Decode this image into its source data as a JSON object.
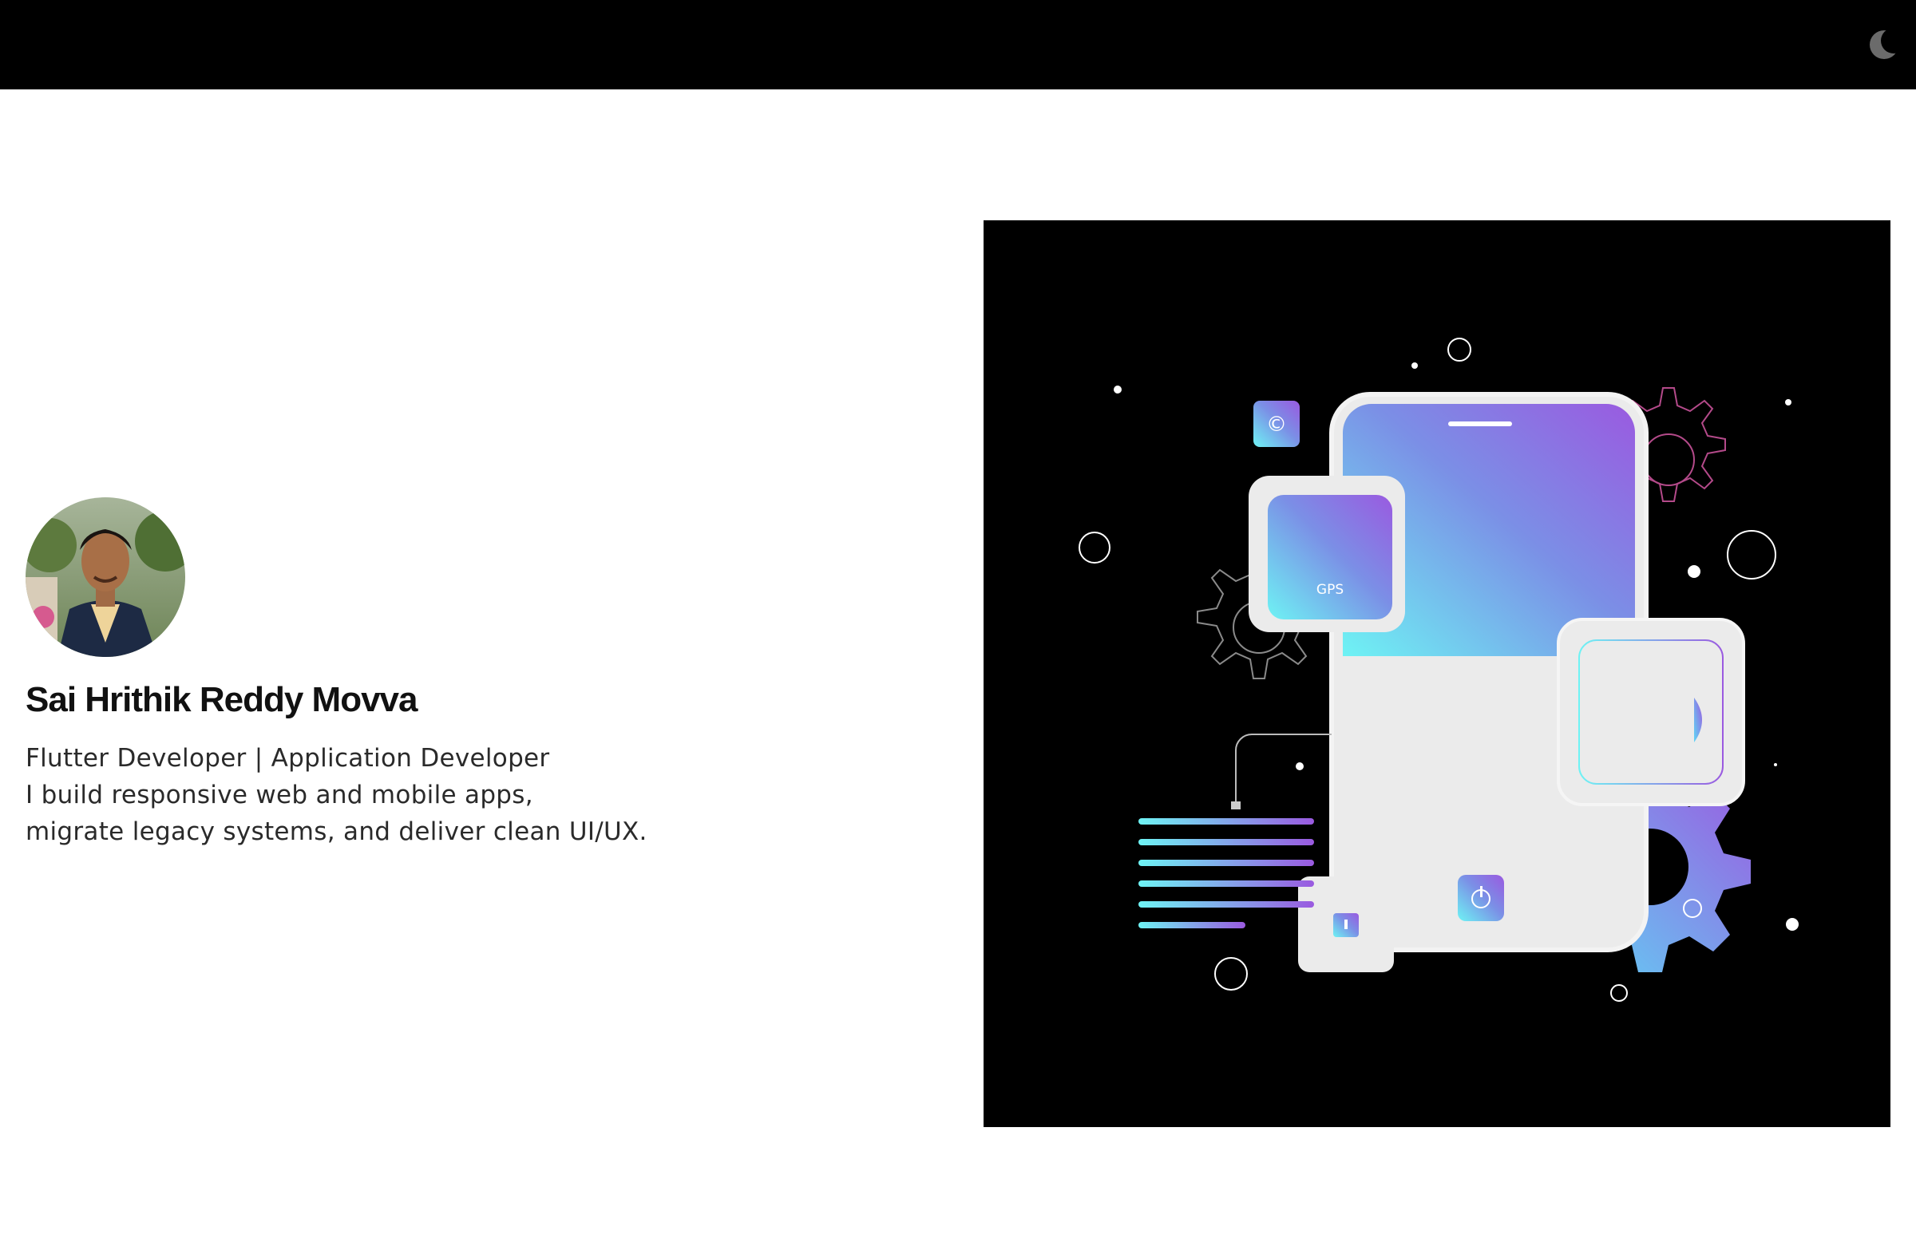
{
  "header": {
    "theme_toggle_icon": "moon-icon",
    "background": "#000000"
  },
  "profile": {
    "avatar_icon": "profile-photo",
    "name": "Sai Hrithik Reddy Movva",
    "role": "Flutter Developer | Application Developer",
    "bio_line1": "I build responsive web and mobile apps,",
    "bio_line2": "migrate legacy systems, and deliver clean UI/UX."
  },
  "hero": {
    "illustration": "mobile-app-development-illustration",
    "gps_label": "GPS",
    "accent_cyan": "#5ef0f0",
    "accent_purple": "#9b5de5"
  }
}
